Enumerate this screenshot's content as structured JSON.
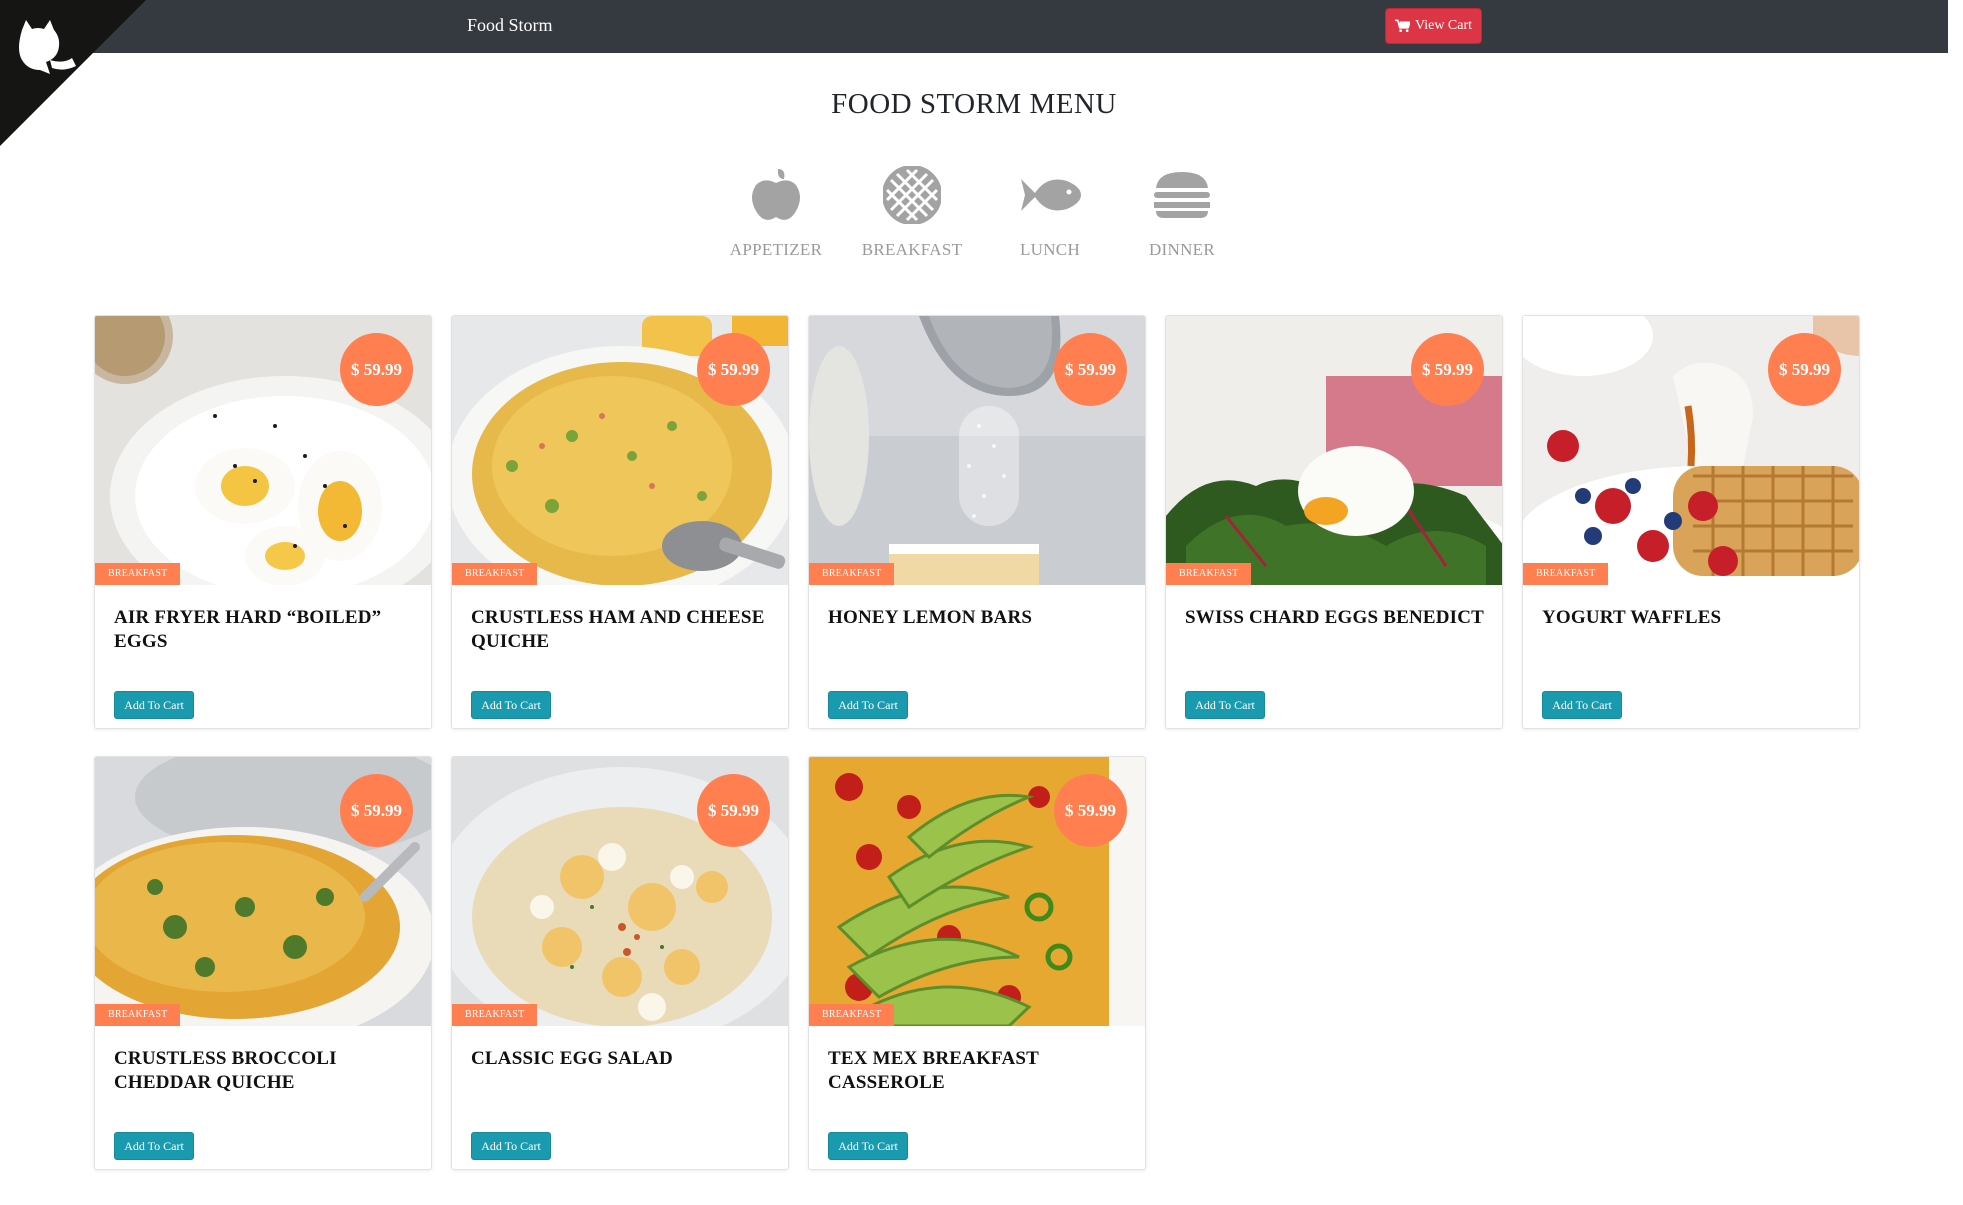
{
  "nav": {
    "brand": "Food Storm",
    "cart_label": "View Cart",
    "cart_color": "#dc3545"
  },
  "page_title": "FOOD STORM MENU",
  "categories": [
    {
      "label": "APPETIZER",
      "icon": "apple-icon"
    },
    {
      "label": "BREAKFAST",
      "icon": "pie-icon"
    },
    {
      "label": "LUNCH",
      "icon": "fish-icon"
    },
    {
      "label": "DINNER",
      "icon": "burger-icon"
    }
  ],
  "accent_color": "#ff7f50",
  "button_color": "#1a9aaf",
  "items": [
    {
      "name": "AIR FRYER HARD “BOILED” EGGS",
      "price": "$ 59.99",
      "tag": "BREAKFAST",
      "button": "Add To Cart"
    },
    {
      "name": "CRUSTLESS HAM AND CHEESE QUICHE",
      "price": "$ 59.99",
      "tag": "BREAKFAST",
      "button": "Add To Cart"
    },
    {
      "name": "HONEY LEMON BARS",
      "price": "$ 59.99",
      "tag": "BREAKFAST",
      "button": "Add To Cart"
    },
    {
      "name": "SWISS CHARD EGGS BENEDICT",
      "price": "$ 59.99",
      "tag": "BREAKFAST",
      "button": "Add To Cart"
    },
    {
      "name": "YOGURT WAFFLES",
      "price": "$ 59.99",
      "tag": "BREAKFAST",
      "button": "Add To Cart"
    },
    {
      "name": "CRUSTLESS BROCCOLI CHEDDAR QUICHE",
      "price": "$ 59.99",
      "tag": "BREAKFAST",
      "button": "Add To Cart"
    },
    {
      "name": "CLASSIC EGG SALAD",
      "price": "$ 59.99",
      "tag": "BREAKFAST",
      "button": "Add To Cart"
    },
    {
      "name": "TEX MEX BREAKFAST CASSEROLE",
      "price": "$ 59.99",
      "tag": "BREAKFAST",
      "button": "Add To Cart"
    }
  ]
}
